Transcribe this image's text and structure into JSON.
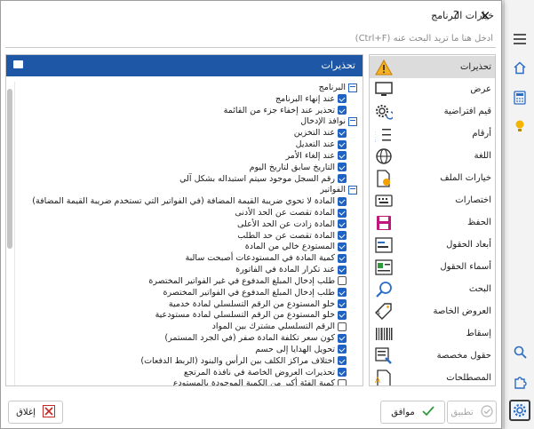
{
  "dialog": {
    "title": "خيارات البرنامج",
    "help_label": "?",
    "close_label": "✕"
  },
  "search": {
    "placeholder": "أدخل هنا ما تريد البحث عنه (Ctrl+F)"
  },
  "categories": [
    {
      "label": "تحذيرات",
      "icon": "warning-icon",
      "selected": true
    },
    {
      "label": "عرض",
      "icon": "monitor-icon"
    },
    {
      "label": "قيم افتراضية",
      "icon": "gear-refresh-icon"
    },
    {
      "label": "أرقام",
      "icon": "numbers-icon"
    },
    {
      "label": "اللغة",
      "icon": "globe-icon"
    },
    {
      "label": "خيارات الملف",
      "icon": "file-settings-icon"
    },
    {
      "label": "اختصارات",
      "icon": "keyboard-icon"
    },
    {
      "label": "الحفظ",
      "icon": "save-icon"
    },
    {
      "label": "أبعاد الحقول",
      "icon": "field-size-icon"
    },
    {
      "label": "أسماء الحقول",
      "icon": "field-names-icon"
    },
    {
      "label": "البحث",
      "icon": "search-icon"
    },
    {
      "label": "العروض الخاصة",
      "icon": "tag-icon"
    },
    {
      "label": "إسقاط",
      "icon": "barcode-icon"
    },
    {
      "label": "حقول مخصصة",
      "icon": "custom-fields-icon"
    },
    {
      "label": "المصطلحات",
      "icon": "terms-icon"
    }
  ],
  "settings": {
    "title": "تحذيرات",
    "rows": [
      {
        "type": "group",
        "label": "البرنامج",
        "indent": 0
      },
      {
        "type": "item",
        "label": "عند إنهاء البرنامج",
        "checked": true,
        "indent": 1
      },
      {
        "type": "item",
        "label": "تحذير عند إخفاء جزء من القائمة",
        "checked": true,
        "indent": 1
      },
      {
        "type": "group",
        "label": "نوافذ الإدخال",
        "indent": 0
      },
      {
        "type": "item",
        "label": "عند التخزين",
        "checked": true,
        "indent": 1
      },
      {
        "type": "item",
        "label": "عند التعديل",
        "checked": true,
        "indent": 1
      },
      {
        "type": "item",
        "label": "عند إلغاء الأمر",
        "checked": true,
        "indent": 1
      },
      {
        "type": "item",
        "label": "التاريخ سابق لتاريخ اليوم",
        "checked": true,
        "indent": 1
      },
      {
        "type": "item",
        "label": "رقم السجل موجود سيتم استبداله بشكل آلي",
        "checked": true,
        "indent": 1
      },
      {
        "type": "group",
        "label": "الفواتير",
        "indent": 0
      },
      {
        "type": "item",
        "label": "المادة لا تحوي ضريبة القيمة المضافة (في الفواتير التي تستخدم ضريبة القيمة المضافة)",
        "checked": true,
        "indent": 1
      },
      {
        "type": "item",
        "label": "المادة تقصت عن الحد الأدنى",
        "checked": true,
        "indent": 1
      },
      {
        "type": "item",
        "label": "المادة زادت عن الحد الأعلى",
        "checked": true,
        "indent": 1
      },
      {
        "type": "item",
        "label": "المادة تقصت عن حد الطلب",
        "checked": true,
        "indent": 1
      },
      {
        "type": "item",
        "label": "المستودع خالي من المادة",
        "checked": true,
        "indent": 1
      },
      {
        "type": "item",
        "label": "كمية المادة في المستودعات أصبحت سالبة",
        "checked": true,
        "indent": 1
      },
      {
        "type": "item",
        "label": "عند تكرار المادة في الفاتورة",
        "checked": true,
        "indent": 1
      },
      {
        "type": "item",
        "label": "طلب إدخال المبلغ المدفوع في غير الفواتير المختصرة",
        "checked": false,
        "indent": 1
      },
      {
        "type": "item",
        "label": "طلب إدخال المبلغ المدفوع في الفواتير المختصرة",
        "checked": true,
        "indent": 1
      },
      {
        "type": "item",
        "label": "خلو المستودع من الرقم التسلسلي لمادة خدمية",
        "checked": true,
        "indent": 1
      },
      {
        "type": "item",
        "label": "خلو المستودع من الرقم التسلسلي لمادة مستودعية",
        "checked": true,
        "indent": 1
      },
      {
        "type": "item",
        "label": "الرقم التسلسلي مشترك بين المواد",
        "checked": false,
        "indent": 1
      },
      {
        "type": "item",
        "label": "كون سعر تكلفة المادة صفر (في الجرد المستمر)",
        "checked": true,
        "indent": 1
      },
      {
        "type": "item",
        "label": "تحويل الهدايا إلى حسم",
        "checked": true,
        "indent": 1
      },
      {
        "type": "item",
        "label": "اختلاف مراكز الكلف بين الرأس والبنود (الربط الدفعات)",
        "checked": true,
        "indent": 1
      },
      {
        "type": "item",
        "label": "تحذيرات العروض الخاصة في نافذة المرتجع",
        "checked": true,
        "indent": 1
      },
      {
        "type": "item",
        "label": "كمية الفئة أكبر من الكمية الموجودة بالمستودع",
        "checked": false,
        "indent": 1
      }
    ]
  },
  "footer": {
    "close_label": "إغلاق",
    "ok_label": "موافق",
    "apply_label": "تطبيق"
  },
  "app_strip": [
    {
      "icon": "menu-icon"
    },
    {
      "icon": "home-icon"
    },
    {
      "icon": "calculator-icon"
    },
    {
      "icon": "lightbulb-icon"
    },
    {
      "icon": "search-icon"
    },
    {
      "icon": "puzzle-icon"
    },
    {
      "icon": "settings-gear-icon",
      "active": true
    }
  ]
}
